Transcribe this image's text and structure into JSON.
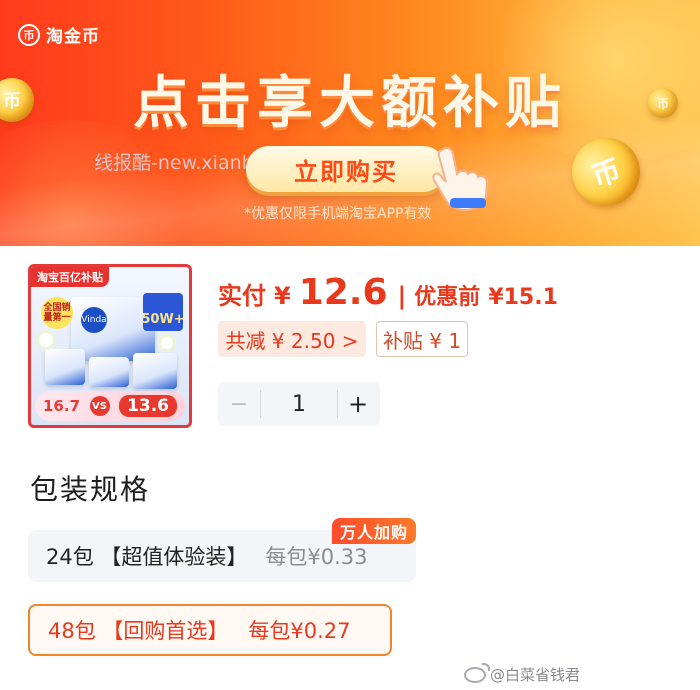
{
  "banner": {
    "brand": "淘金币",
    "brand_logo_glyph": "币",
    "headline": "点击享大额补贴",
    "buy_button": "立即购买",
    "watermark": "线报酷-new.xianbao.fun",
    "disclaimer": "*优惠仅限手机端淘宝APP有效",
    "coin_glyph": "币",
    "hand_icon": "pointing-hand-icon",
    "colors": {
      "primary": "#ff3a1c",
      "accent": "#ffc44f",
      "button_text": "#ff4a14"
    }
  },
  "product": {
    "thumb_tag": "淘宝百亿补贴",
    "thumb_logo": "Vinda",
    "thumb_badge": "全国销量第一",
    "thumb_promo": "50W+",
    "thumb_price_before": "16.7",
    "thumb_vs": "VS",
    "thumb_price_after": "13.6",
    "pay_label": "实付",
    "currency": "¥",
    "price": "12.6",
    "separator": "|",
    "original_label": "优惠前",
    "original_price": "¥15.1",
    "reduce_chip": "共减 ¥ 2.50 >",
    "subsidy_chip": "补贴 ¥ 1",
    "quantity": {
      "minus": "−",
      "value": "1",
      "plus": "+"
    },
    "colors": {
      "price_red": "#e8391d"
    }
  },
  "spec": {
    "title": "包装规格",
    "hot_tag": "万人加购",
    "options": [
      {
        "name": "24包 【超值体验装】",
        "unit_price": "每包¥0.33",
        "selected": false
      },
      {
        "name": "48包 【回购首选】",
        "unit_price": "每包¥0.27",
        "selected": true
      }
    ],
    "colors": {
      "selected_border": "#f0862a"
    }
  },
  "footer": {
    "weibo_icon": "weibo-icon",
    "watermark": "@白菜省钱君"
  }
}
